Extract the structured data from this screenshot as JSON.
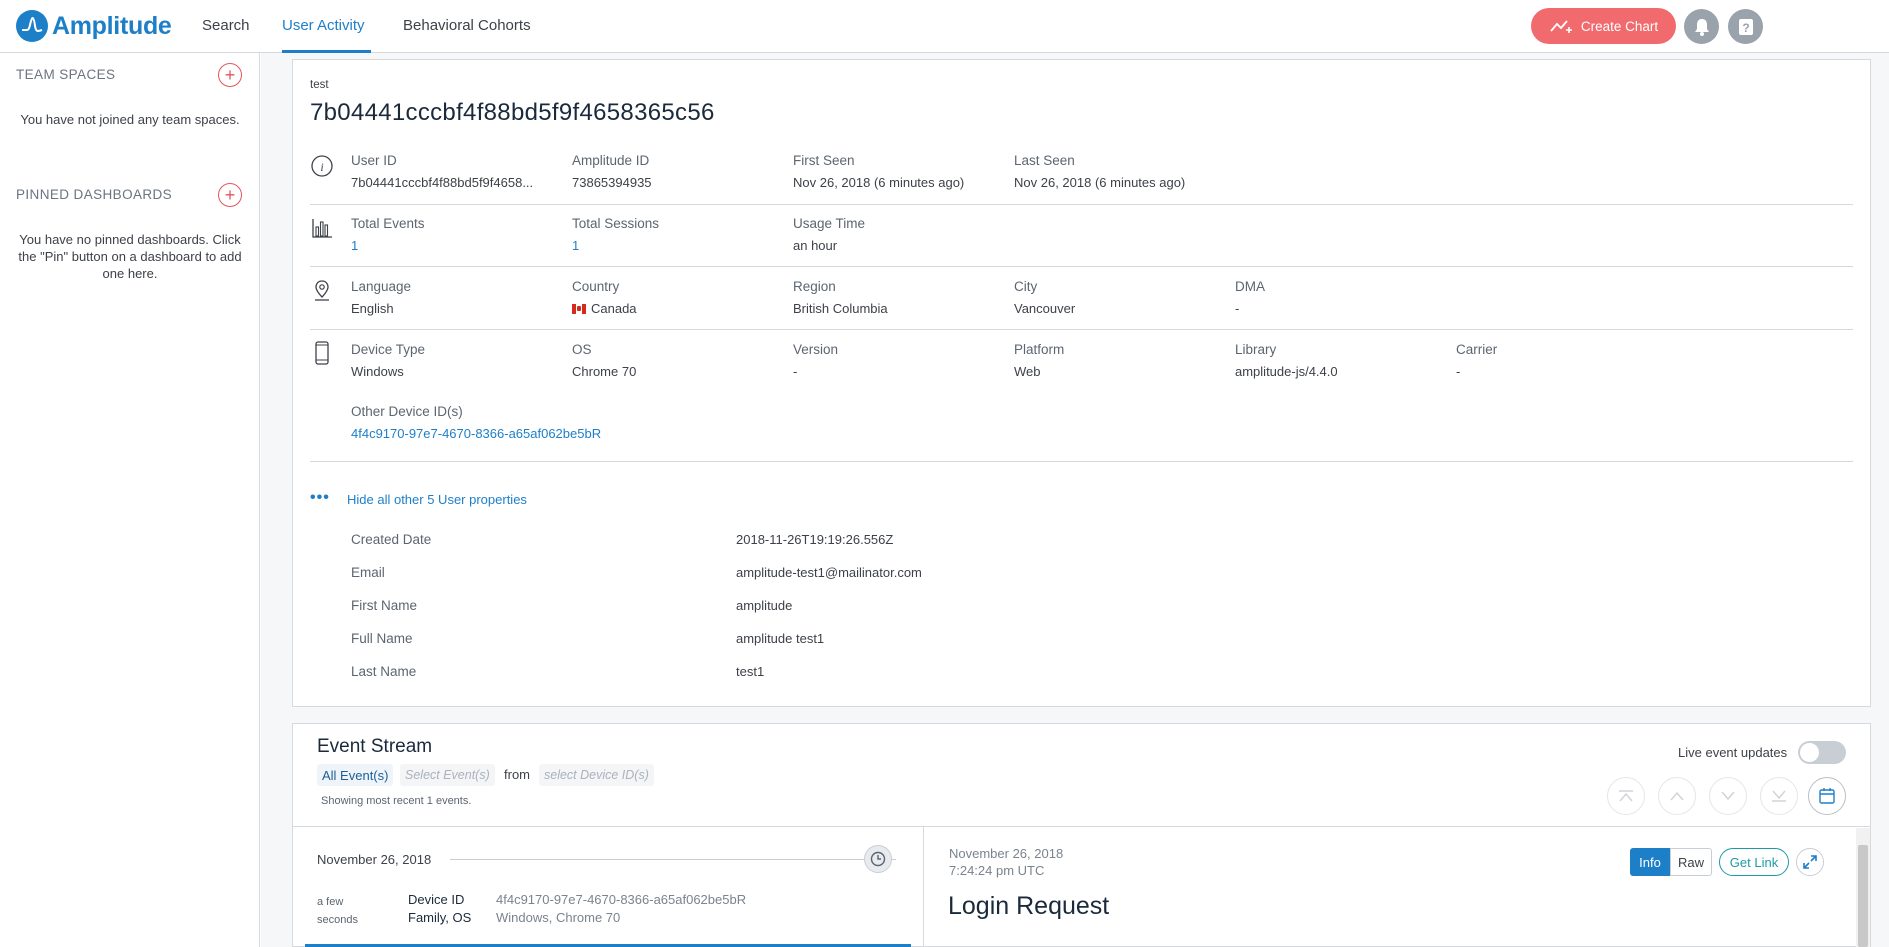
{
  "brand": {
    "name": "Amplitude",
    "color": "#1e7fc9"
  },
  "nav": {
    "search": "Search",
    "user_activity": "User Activity",
    "behavioral_cohorts": "Behavioral Cohorts"
  },
  "header_actions": {
    "create_chart": "Create Chart",
    "notifications_icon": "bell-icon",
    "help_icon": "question-icon",
    "accent": "#f06a6e"
  },
  "sidebar": {
    "team_spaces_title": "TEAM SPACES",
    "team_spaces_empty": "You have not joined any team spaces.",
    "pinned_title": "PINNED DASHBOARDS",
    "pinned_empty": "You have no pinned dashboards. Click the \"Pin\" button on a dashboard to add one here."
  },
  "user": {
    "label": "test",
    "id": "7b04441cccbf4f88bd5f9f4658365c56",
    "identity": [
      {
        "label": "User ID",
        "value": "7b04441cccbf4f88bd5f9f4658..."
      },
      {
        "label": "Amplitude ID",
        "value": "73865394935"
      },
      {
        "label": "First Seen",
        "value": "Nov 26, 2018 (6 minutes ago)"
      },
      {
        "label": "Last Seen",
        "value": "Nov 26, 2018 (6 minutes ago)"
      }
    ],
    "usage": [
      {
        "label": "Total Events",
        "value": "1"
      },
      {
        "label": "Total Sessions",
        "value": "1"
      },
      {
        "label": "Usage Time",
        "value": "an hour"
      }
    ],
    "location": [
      {
        "label": "Language",
        "value": "English"
      },
      {
        "label": "Country",
        "value": "Canada"
      },
      {
        "label": "Region",
        "value": "British Columbia"
      },
      {
        "label": "City",
        "value": "Vancouver"
      },
      {
        "label": "DMA",
        "value": "-"
      }
    ],
    "device": [
      {
        "label": "Device Type",
        "value": "Windows"
      },
      {
        "label": "OS",
        "value": "Chrome 70"
      },
      {
        "label": "Version",
        "value": "-"
      },
      {
        "label": "Platform",
        "value": "Web"
      },
      {
        "label": "Library",
        "value": "amplitude-js/4.4.0"
      },
      {
        "label": "Carrier",
        "value": "-"
      }
    ],
    "other_device_label": "Other Device ID(s)",
    "other_device_value": "4f4c9170-97e7-4670-8366-a65af062be5bR",
    "hide_props": "Hide all other 5 User properties",
    "properties": [
      {
        "name": "Created Date",
        "value": "2018-11-26T19:19:26.556Z"
      },
      {
        "name": "Email",
        "value": "amplitude-test1@mailinator.com"
      },
      {
        "name": "First Name",
        "value": "amplitude"
      },
      {
        "name": "Full Name",
        "value": "amplitude test1"
      },
      {
        "name": "Last Name",
        "value": "test1"
      }
    ]
  },
  "event_stream": {
    "title": "Event Stream",
    "all_events": "All Event(s)",
    "select_events": "Select Event(s)",
    "from": "from",
    "select_device": "select Device ID(s)",
    "showing": "Showing most recent 1 events.",
    "live_updates": "Live event updates",
    "date_header": "November 26, 2018",
    "event_time": "a few seconds",
    "event_fields": [
      {
        "label": "Device ID",
        "value": "4f4c9170-97e7-4670-8366-a65af062be5bR"
      },
      {
        "label": "Family, OS",
        "value": "Windows, Chrome 70"
      }
    ],
    "detail": {
      "date": "November 26, 2018",
      "time": "7:24:24 pm UTC",
      "name": "Login Request",
      "tabs": [
        "Info",
        "Raw"
      ],
      "get_link": "Get Link"
    }
  }
}
